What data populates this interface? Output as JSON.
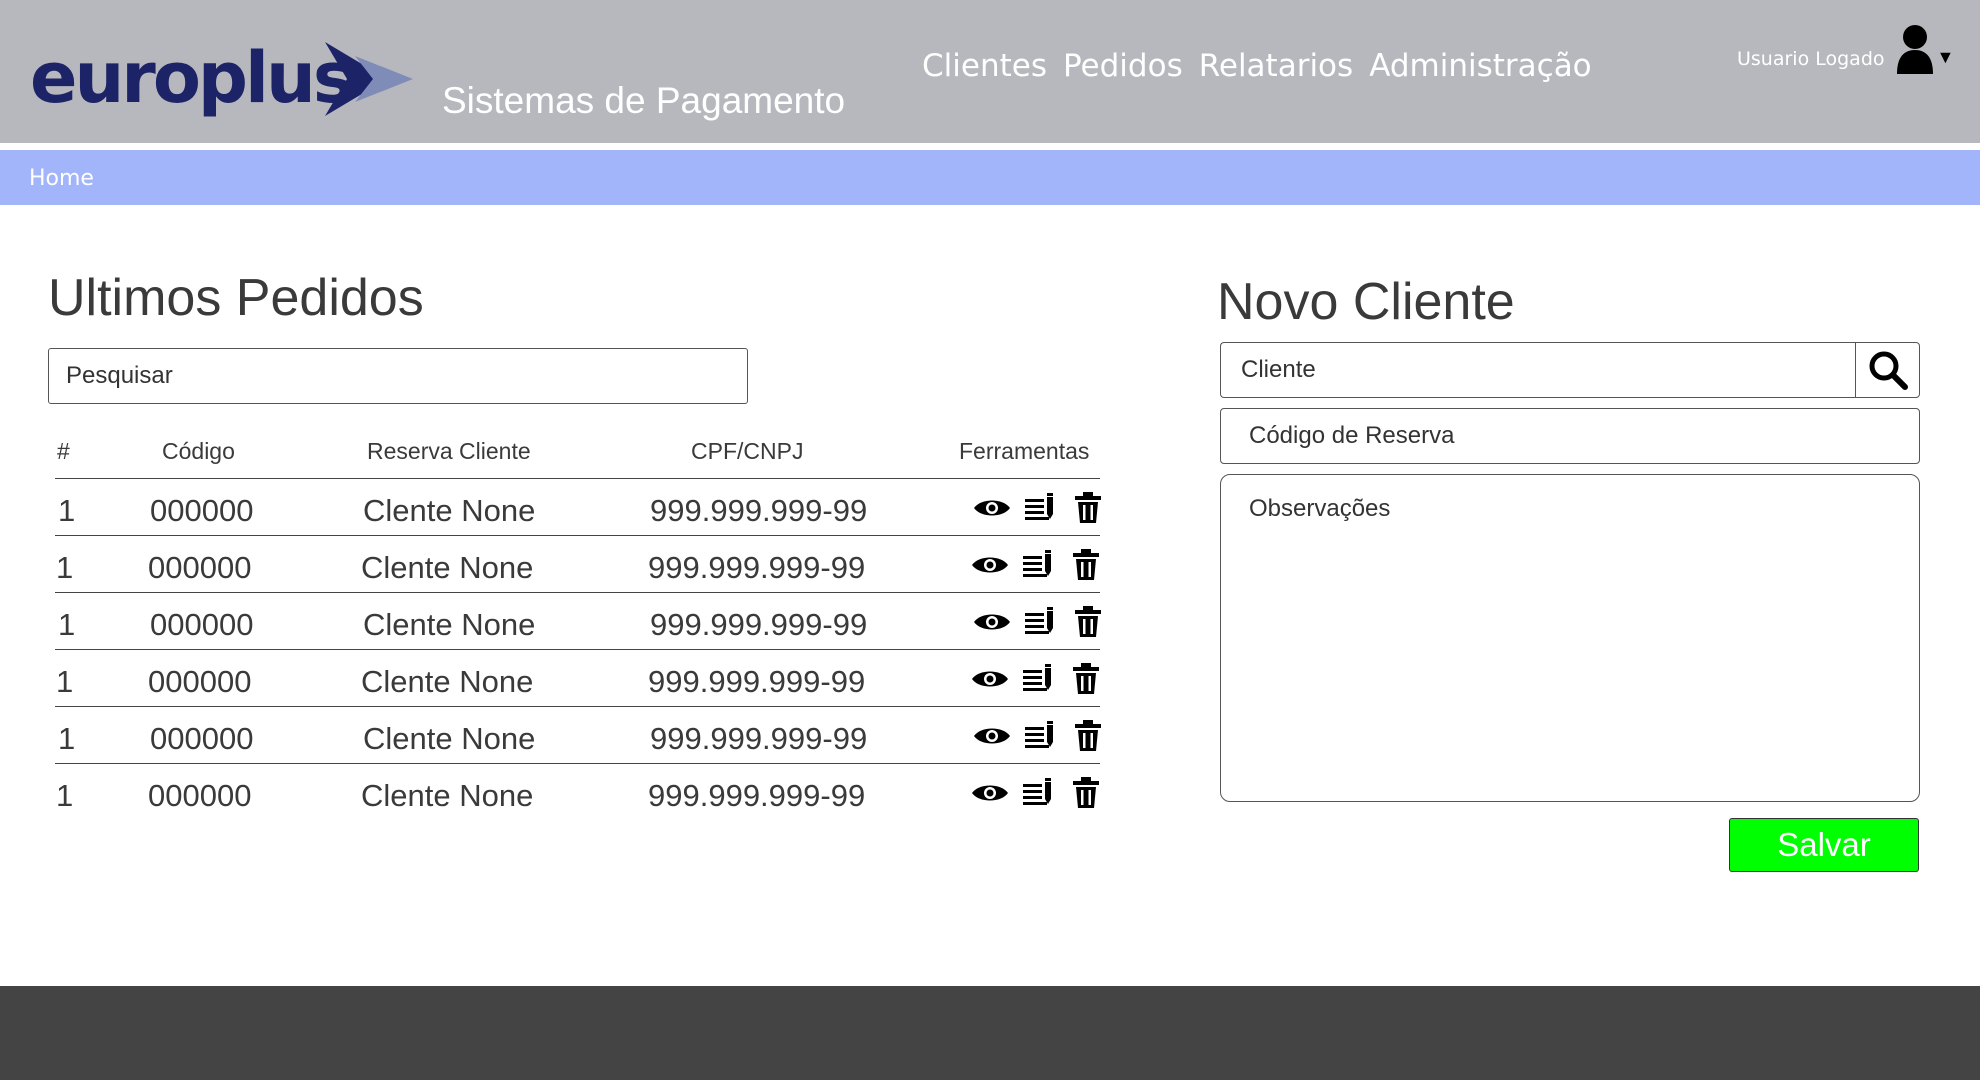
{
  "brand": {
    "logo_text": "europlus",
    "tagline": "Sistemas de Pagamento",
    "logo_color": "#1c2366",
    "arrow_color": "#7f8cb8"
  },
  "nav": {
    "items": [
      {
        "label": "Clientes"
      },
      {
        "label": "Pedidos"
      },
      {
        "label": "Relatarios"
      },
      {
        "label": "Administração"
      }
    ]
  },
  "user": {
    "name": "Usuario Logado",
    "icon": "user-icon",
    "dropdown_icon": "caret-down-icon"
  },
  "breadcrumb": {
    "items": [
      {
        "label": "Home"
      }
    ]
  },
  "orders": {
    "title": "Ultimos Pedidos",
    "search_placeholder": "Pesquisar",
    "columns": [
      "#",
      "Código",
      "Reserva Cliente",
      "CPF/CNPJ",
      "Ferramentas"
    ],
    "rows": [
      {
        "num": "1",
        "code": "000000",
        "client": "Clente None",
        "doc": "999.999.999-99"
      },
      {
        "num": "1",
        "code": "000000",
        "client": "Clente None",
        "doc": "999.999.999-99"
      },
      {
        "num": "1",
        "code": "000000",
        "client": "Clente None",
        "doc": "999.999.999-99"
      },
      {
        "num": "1",
        "code": "000000",
        "client": "Clente None",
        "doc": "999.999.999-99"
      },
      {
        "num": "1",
        "code": "000000",
        "client": "Clente None",
        "doc": "999.999.999-99"
      },
      {
        "num": "1",
        "code": "000000",
        "client": "Clente None",
        "doc": "999.999.999-99"
      }
    ],
    "tool_icons": [
      "eye-icon",
      "edit-list-icon",
      "trash-icon"
    ]
  },
  "new_client": {
    "title": "Novo Cliente",
    "cliente_placeholder": "Cliente",
    "codigo_placeholder": "Código de Reserva",
    "obs_placeholder": "Observações",
    "save_label": "Salvar",
    "save_color": "#00ff00",
    "search_icon": "search-icon"
  },
  "colors": {
    "header_bg": "#b6b8bd",
    "breadcrumb_bg": "#a2b5fb",
    "footer_bg": "#444444"
  }
}
